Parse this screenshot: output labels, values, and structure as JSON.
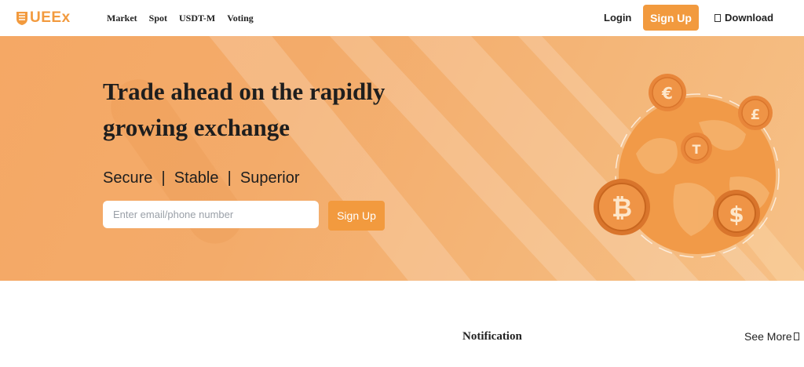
{
  "brand": {
    "name": "UEEx",
    "color": "#f29a3e"
  },
  "nav": {
    "links": [
      "Market",
      "Spot",
      "USDT-M",
      "Voting"
    ],
    "login": "Login",
    "signup": "Sign Up",
    "download": "Download",
    "download_icon": "download-icon"
  },
  "hero": {
    "title": "Trade ahead on the rapidly growing exchange",
    "tagline": "Secure  |  Stable  |  Superior",
    "input_placeholder": "Enter email/phone number",
    "input_value": "",
    "signup": "Sign Up",
    "coins": [
      "euro-coin-icon",
      "pound-coin-icon",
      "tether-coin-icon",
      "bitcoin-coin-icon",
      "dollar-coin-icon"
    ],
    "colors": {
      "accent": "#f29a3e",
      "hero_bg": "#f4b072"
    }
  },
  "notifications": {
    "title": "Notification",
    "see_more": "See More",
    "see_more_icon": "arrow-right-icon"
  }
}
